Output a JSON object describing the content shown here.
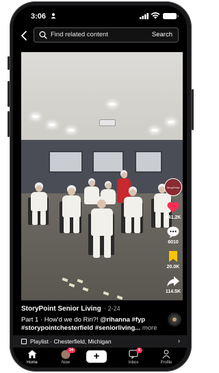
{
  "status_bar": {
    "time": "3:06"
  },
  "search": {
    "placeholder": "Find related content",
    "button": "Search"
  },
  "video": {
    "channel_badge": "StoryPoint",
    "likes": "441.2K",
    "comments": "6010",
    "saves": "20.0K",
    "shares": "114.5K"
  },
  "caption": {
    "author": "StoryPoint Senior Living",
    "date": "· 2-24",
    "line1_prefix": "Part 1 · How'd we do Riri?! ",
    "line1_tags": "@rihanna #fyp",
    "line2_tags": "#storypointchesterfield #seniorliving...",
    "more": "more"
  },
  "playlist": {
    "label": "Playlist · Chesterfield, Michigan"
  },
  "nav": {
    "home": "Home",
    "now": "Now",
    "now_badge": "24",
    "inbox": "Inbox",
    "inbox_badge": "6",
    "profile": "Profile"
  },
  "colors": {
    "accent": "#fe2c55",
    "cyan": "#25f4ee",
    "save": "#f9c500"
  }
}
